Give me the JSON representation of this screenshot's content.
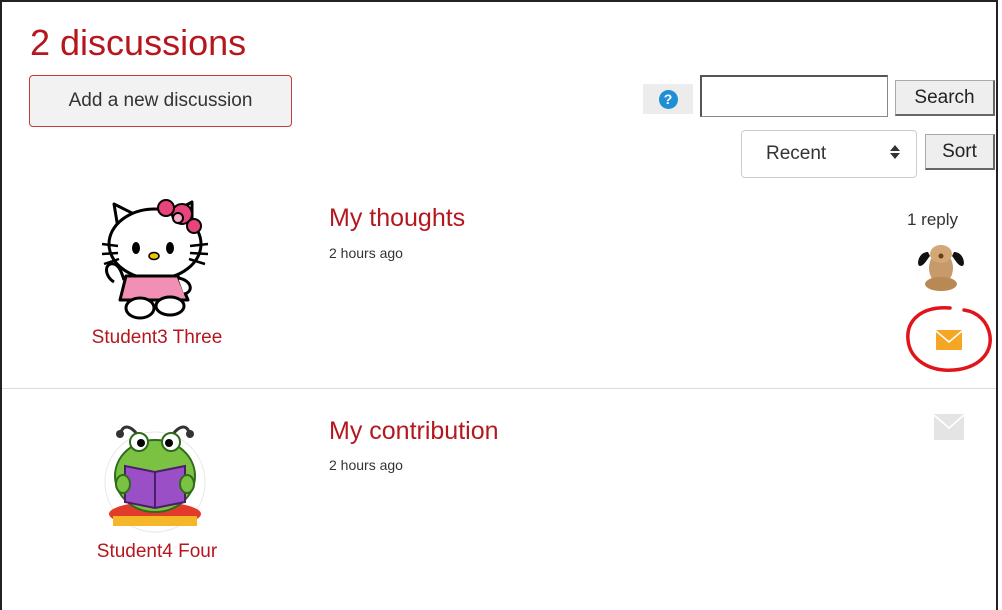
{
  "page": {
    "title": "2 discussions",
    "add_button_label": "Add a new discussion",
    "help_icon_symbol": "?",
    "search": {
      "value": "",
      "button_label": "Search"
    },
    "sort": {
      "selected": "Recent",
      "button_label": "Sort"
    },
    "colors": {
      "accent": "#b5171f",
      "help": "#1f8fd4",
      "mail_active": "#f5a623",
      "mail_inactive": "#e4e4e4",
      "highlight_circle": "#e0151b"
    }
  },
  "discussions": [
    {
      "author": "Student3 Three",
      "avatar_icon": "hello-kitty-avatar-icon",
      "title": "My thoughts",
      "time": "2 hours ago",
      "replies": "1 reply",
      "replier_icon": "dog-avatar-icon",
      "mail_icon": "envelope-icon-highlighted"
    },
    {
      "author": "Student4 Four",
      "avatar_icon": "frog-reading-avatar-icon",
      "title": "My contribution",
      "time": "2 hours ago",
      "replies": "",
      "mail_icon": "envelope-icon-inactive"
    }
  ]
}
